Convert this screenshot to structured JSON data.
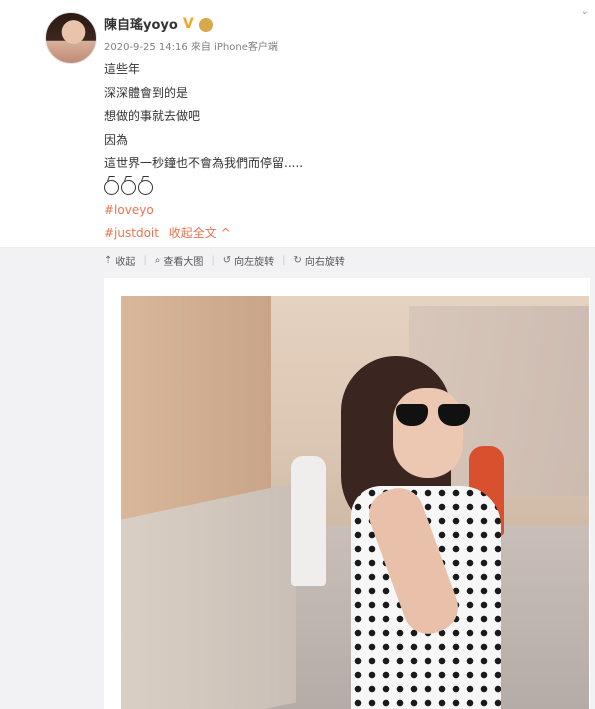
{
  "post": {
    "username": "陳自瑤yoyo",
    "verified_mark": "V",
    "meta": "2020-9-25 14:16 來自 iPhone客户端",
    "lines": [
      "這些年",
      "深深體會到的是",
      "想做的事就去做吧",
      "因為",
      "這世界一秒鐘也不會為我們而停留....."
    ],
    "hashtag1": "#loveyo",
    "hashtag2": "#justdoit",
    "collapse_label": "收起全文 ^"
  },
  "toolbar": {
    "collapse": "收起",
    "view_large": "查看大图",
    "rotate_left": "向左旋转",
    "rotate_right": "向右旋转"
  },
  "icons": {
    "dropdown": "chevron-down-icon",
    "collapse": "upload-arrow-icon",
    "view_large": "search-icon",
    "rotate_left": "rotate-left-icon",
    "rotate_right": "rotate-right-icon"
  },
  "colors": {
    "accent": "#eb7350",
    "verified": "#f5a623"
  }
}
